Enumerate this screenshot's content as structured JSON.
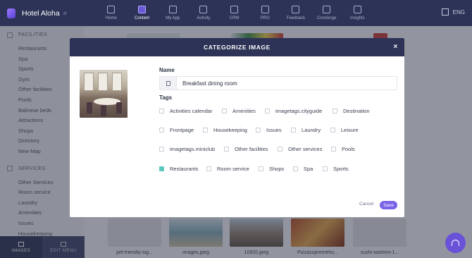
{
  "app": {
    "name": "Hotel Aloha",
    "badge": "⌀"
  },
  "nav": [
    {
      "label": "Home",
      "icon": "home-icon",
      "active": false
    },
    {
      "label": "Content",
      "icon": "content-icon",
      "active": true
    },
    {
      "label": "My App",
      "icon": "phone-icon",
      "active": false
    },
    {
      "label": "Activity",
      "icon": "activity-icon",
      "active": false
    },
    {
      "label": "CRM",
      "icon": "crm-icon",
      "active": false
    },
    {
      "label": "PRO",
      "icon": "pro-icon",
      "active": false
    },
    {
      "label": "Feedback",
      "icon": "thumb-icon",
      "active": false
    },
    {
      "label": "Concierge",
      "icon": "chat-icon",
      "active": false
    },
    {
      "label": "Insights",
      "icon": "chart-icon",
      "active": false
    }
  ],
  "lang": "ENG",
  "sidebar": {
    "facilities_head": "FACILITIES",
    "facilities": [
      "Restaurants",
      "Spa",
      "Sports",
      "Gym",
      "Other facilities",
      "Pools",
      "Balinese beds",
      "Attractions",
      "Shops",
      "Directory",
      "New Map"
    ],
    "services_head": "SERVICES",
    "services": [
      "Other Services",
      "Room service",
      "Laundry",
      "Amenities",
      "Issues",
      "Housekeeping"
    ],
    "tab_images": "IMAGES",
    "tab_edit_menu": "EDIT MENU"
  },
  "gallery": [
    "pet-friendly-sig...",
    "images.jpeg",
    "10920.jpeg",
    "Pizzasupremeho...",
    "sushi-sashimi-1..."
  ],
  "modal": {
    "title": "CATEGORIZE IMAGE",
    "close": "×",
    "name_label": "Name",
    "name_value": "Breakfast dining room",
    "tags_label": "Tags",
    "tags_row1": [
      "Activities calendar",
      "Amenities",
      "imagetags.cityguide",
      "Destination"
    ],
    "tags_row2": [
      "Frontpage",
      "Housekeeping",
      "Issues",
      "Laundry",
      "Leisure"
    ],
    "tags_row3": [
      "imagetags.miniclub",
      "Other facilities",
      "Other services",
      "Pools"
    ],
    "tags_row4": [
      "Restaurants",
      "Room service",
      "Shops",
      "Spa",
      "Sports"
    ],
    "checked_tag": "Restaurants",
    "cancel": "Cancel",
    "save": "Save"
  },
  "colors": {
    "nav_bg": "#2c3356",
    "accent": "#7b63e8",
    "checked": "#5ec8c0"
  }
}
